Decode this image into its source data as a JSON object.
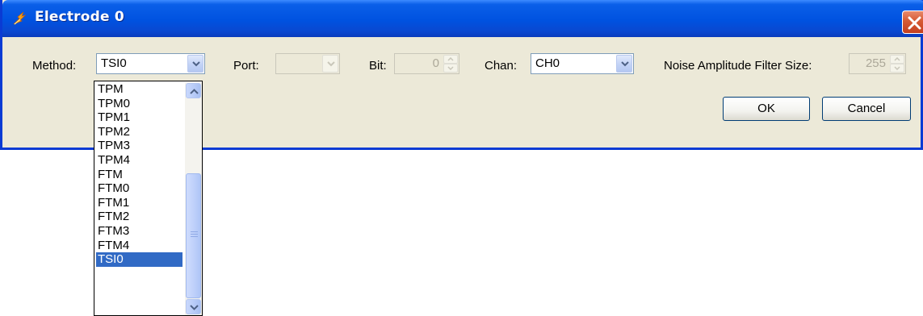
{
  "window": {
    "title": "Electrode 0"
  },
  "form": {
    "method_label": "Method:",
    "method_value": "TSI0",
    "port_label": "Port:",
    "port_value": "",
    "bit_label": "Bit:",
    "bit_value": "0",
    "chan_label": "Chan:",
    "chan_value": "CH0",
    "noise_label": "Noise Amplitude Filter Size:",
    "noise_value": "255"
  },
  "buttons": {
    "ok": "OK",
    "cancel": "Cancel"
  },
  "method_options": [
    "TPM",
    "TPM0",
    "TPM1",
    "TPM2",
    "TPM3",
    "TPM4",
    "FTM",
    "FTM0",
    "FTM1",
    "FTM2",
    "FTM3",
    "FTM4",
    "TSI0"
  ],
  "selected_option": "TSI0",
  "colors": {
    "titlebar": "#0052e0",
    "selection": "#316ac5",
    "close": "#d65a33",
    "dialog_bg": "#ece9d8"
  },
  "icons": {
    "app": "app-logo-icon",
    "close": "close-icon",
    "dropdown": "chevron-down-icon",
    "spin_up": "spin-up-icon",
    "spin_down": "spin-down-icon"
  }
}
